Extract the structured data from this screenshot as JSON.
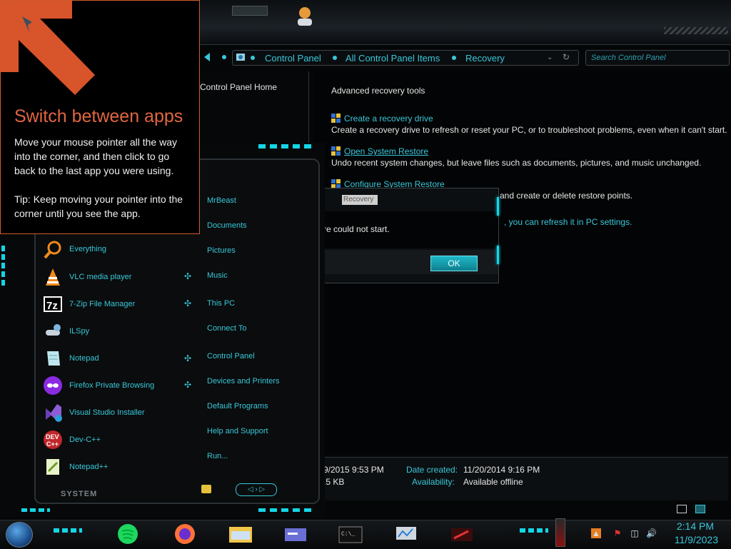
{
  "tooltip": {
    "title": "Switch between apps",
    "body": "Move your mouse pointer all the way into the corner, and then click to go back to the last app you were using.",
    "tip": "Tip: Keep moving your pointer into the corner until you see the app."
  },
  "control_panel": {
    "breadcrumbs": [
      "Control Panel",
      "All Control Panel Items",
      "Recovery"
    ],
    "search_placeholder": "Search Control Panel",
    "left_pane_link": "Control Panel Home",
    "heading": "Advanced recovery tools",
    "items": [
      {
        "link": "Create a recovery drive",
        "desc": "Create a recovery drive to refresh or reset your PC, or to troubleshoot problems, even when it can't start."
      },
      {
        "link": "Open System Restore",
        "desc": "Undo recent system changes, but leave files such as documents, pictures, and music unchanged."
      },
      {
        "link": "Configure System Restore",
        "desc": "and create or delete restore points."
      }
    ],
    "refresh_link": ", you can refresh it in PC settings.",
    "details": {
      "modified_partial": "9/2015 9:53 PM",
      "created_label": "Date created:",
      "created_value": "11/20/2014 9:16 PM",
      "size_partial": ".5 KB",
      "availability_label": "Availability:",
      "availability_value": "Available offline"
    }
  },
  "dialog": {
    "title": "Recovery",
    "message_partial": "re could not start.",
    "ok_label": "OK"
  },
  "start_menu": {
    "programs": [
      {
        "label": "Everything",
        "icon": "magnifier-icon"
      },
      {
        "label": "VLC media player",
        "icon": "vlc-cone-icon"
      },
      {
        "label": "7-Zip File Manager",
        "icon": "7zip-icon"
      },
      {
        "label": "ILSpy",
        "icon": "ilspy-icon"
      },
      {
        "label": "Notepad",
        "icon": "notepad-icon"
      },
      {
        "label": "Firefox Private Browsing",
        "icon": "firefox-private-icon"
      },
      {
        "label": "Visual Studio Installer",
        "icon": "visual-studio-icon"
      },
      {
        "label": "Dev-C++",
        "icon": "devcpp-icon"
      },
      {
        "label": "Notepad++",
        "icon": "notepadpp-icon"
      }
    ],
    "places": [
      "MrBeast",
      "Documents",
      "Pictures",
      "Music",
      "This PC",
      "Connect To",
      "Control Panel",
      "Devices and Printers",
      "Default Programs",
      "Help and Support",
      "Run..."
    ],
    "system_label": "SYSTEM"
  },
  "taskbar": {
    "apps": [
      "spotify-icon",
      "firefox-icon",
      "file-explorer-icon",
      "taskbar-app-icon",
      "command-prompt-icon",
      "resource-monitor-icon",
      "taskbar-app-red-icon"
    ],
    "time": "2:14 PM",
    "date": "11/9/2023"
  },
  "colors": {
    "accent": "#39c7d9",
    "tooltip_title": "#e06640"
  }
}
